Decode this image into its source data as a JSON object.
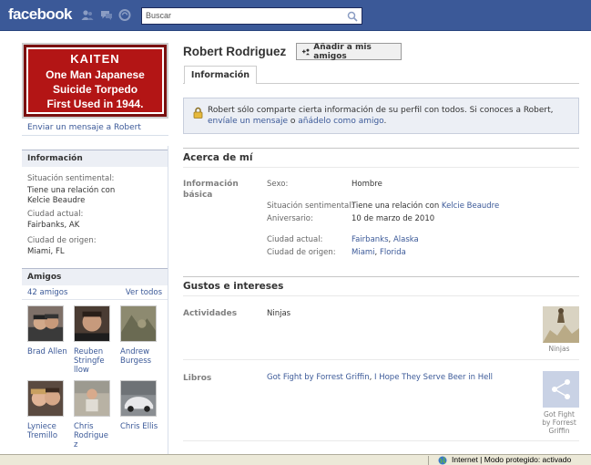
{
  "header": {
    "logo": "facebook",
    "search_placeholder": "Buscar",
    "icons": [
      "friend-requests-icon",
      "messages-icon",
      "notifications-icon",
      "search-icon"
    ]
  },
  "profile": {
    "name": "Robert Rodriguez",
    "add_friend_label": "Añadir a mis amigos",
    "tab_info": "Información",
    "send_message": "Enviar un mensaje a Robert",
    "picture_text": [
      "KAITEN",
      "One Man Japanese",
      "Suicide Torpedo",
      "First Used in 1944."
    ]
  },
  "notice": {
    "text": "Robert sólo comparte cierta información de su perfil con todos. Si conoces a Robert, ",
    "link1": "envíale un mensaje",
    "mid": " o ",
    "link2": "añádelo como amigo",
    "end": "."
  },
  "sidebar": {
    "info_title": "Información",
    "relationship_label": "Situación sentimental:",
    "relationship_value": "Tiene una relación con",
    "relationship_partner": "Kelcie Beaudre",
    "city_label": "Ciudad actual:",
    "city_value": "Fairbanks, AK",
    "hometown_label": "Ciudad de origen:",
    "hometown_value": "Miami, FL",
    "friends_title": "Amigos",
    "friends_count": "42 amigos",
    "see_all": "Ver todos",
    "friends": [
      {
        "name": "Brad Allen"
      },
      {
        "name": "Reuben Stringfe llow"
      },
      {
        "name": "Andrew Burgess"
      },
      {
        "name": "Lyniece Tremillo"
      },
      {
        "name": "Chris Rodrigue z"
      },
      {
        "name": "Chris Ellis"
      }
    ]
  },
  "about": {
    "title": "Acerca de mí",
    "basic_label": "Información básica",
    "sex_label": "Sexo:",
    "sex_value": "Hombre",
    "relationship_label": "Situación sentimental:",
    "relationship_value": "Tiene una relación con",
    "relationship_partner": "Kelcie Beaudre",
    "anniversary_label": "Aniversario:",
    "anniversary_value": "10 de marzo de 2010",
    "city_label": "Ciudad actual:",
    "city_link1": "Fairbanks",
    "city_link2": "Alaska",
    "hometown_label": "Ciudad de origen:",
    "hometown_link1": "Miami",
    "hometown_link2": "Florida"
  },
  "likes": {
    "title": "Gustos e intereses",
    "activities_label": "Actividades",
    "activities_value": "Ninjas",
    "activities_thumb_caption": "Ninjas",
    "books_label": "Libros",
    "book1": "Got Fight by Forrest Griffin",
    "book2": "I Hope They Serve Beer in Hell",
    "books_thumb_caption": "Got Fight by Forrest Griffin"
  },
  "statusbar": {
    "text": "Internet | Modo protegido: activado"
  },
  "colors": {
    "brand": "#3b5998",
    "link": "#3b5998",
    "box_head_bg": "#eceff5"
  }
}
